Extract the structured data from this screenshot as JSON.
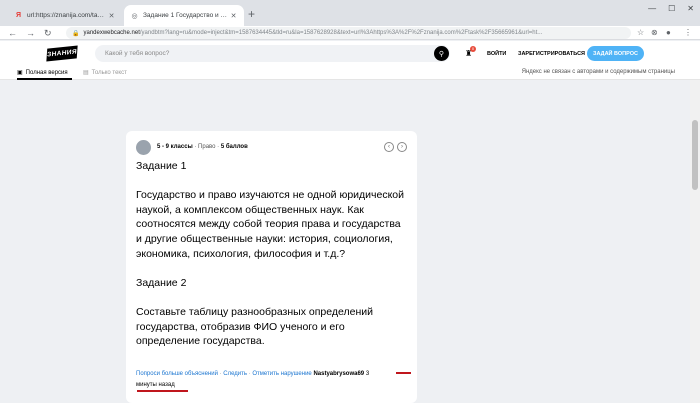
{
  "browser": {
    "tabs": [
      {
        "title": "url:https://znanija.com/task/35665",
        "active": false
      },
      {
        "title": "Задание 1 Государство и право и",
        "active": true
      }
    ],
    "new_tab": "+",
    "window_controls": [
      "—",
      "☐",
      "✕"
    ],
    "address_host": "yandexwebcache.net",
    "address_path": "/yandbtm?lang=ru&mode=inject&tm=1587634445&tld=ru&la=1587628928&text=url%3Ahttps%3A%2F%2Fznanija.com%2Ftask%2F35665961&url=ht..."
  },
  "site": {
    "logo": "ЗНАНИЯ",
    "search_placeholder": "Какой у тебя вопрос?",
    "notif_count": "0",
    "login": "ВОЙТИ",
    "register": "ЗАРЕГИСТРИРОВАТЬСЯ",
    "ask": "ЗАДАЙ ВОПРОС"
  },
  "cache_bar": {
    "full_version": "Полная версия",
    "text_only": "Только текст",
    "note": "Яндекс не связан с авторами и содержимым страницы"
  },
  "question": {
    "grade": "5 - 9 классы",
    "subject": "Право",
    "points": "5 баллов",
    "meta_sep": "·",
    "task1_title": "Задание 1",
    "task1_body": "Государство и право изучаются не одной юридической наукой, а комплексом общественных наук. Как соотносятся между собой теория права и государства и другие общественные науки: история, социология, экономика, психология, философия и т.д.?",
    "task2_title": "Задание 2",
    "task2_body": "Составьте таблицу разнообразных определений государства, отобразив ФИО ученого и его определение государства.",
    "footer": {
      "ask_more": "Попроси больше объяснений",
      "follow": "Следить",
      "report": "Отметить нарушение",
      "sep": "·",
      "author": "Nastyabrysowa69",
      "time_part1": "3",
      "time_part2": "минуты назад"
    }
  },
  "colors": {
    "accent_blue": "#4fb3f6",
    "link_blue": "#1b75d0",
    "annotation_red": "#c0161d"
  }
}
